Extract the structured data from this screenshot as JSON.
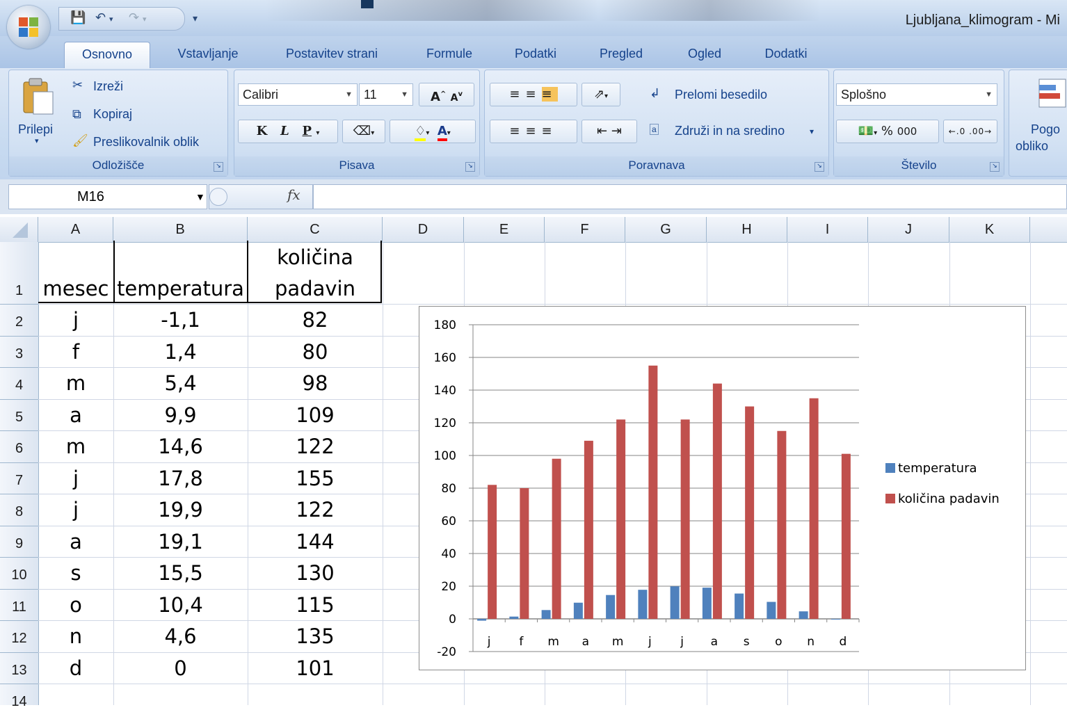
{
  "window": {
    "title": "Ljubljana_klimogram - Mi"
  },
  "qat": {
    "save_icon": "save-icon",
    "undo_icon": "undo-icon",
    "redo_icon": "redo-icon"
  },
  "tabs": [
    {
      "label": "Osnovno",
      "active": true
    },
    {
      "label": "Vstavljanje"
    },
    {
      "label": "Postavitev strani"
    },
    {
      "label": "Formule"
    },
    {
      "label": "Podatki"
    },
    {
      "label": "Pregled"
    },
    {
      "label": "Ogled"
    },
    {
      "label": "Dodatki"
    }
  ],
  "ribbon": {
    "clipboard": {
      "label": "Odložišče",
      "paste": "Prilepi",
      "cut": "Izreži",
      "copy": "Kopiraj",
      "format_painter": "Preslikovalnik oblik"
    },
    "font": {
      "label": "Pisava",
      "font_name": "Calibri",
      "font_size": "11",
      "bold": "K",
      "italic": "L",
      "underline": "P"
    },
    "alignment": {
      "label": "Poravnava",
      "wrap": "Prelomi besedilo",
      "merge": "Združi in na sredino"
    },
    "number": {
      "label": "Število",
      "format": "Splošno",
      "percent": "%",
      "thousands": "000"
    },
    "styles": {
      "label_1": "Pogo",
      "label_2": "obliko"
    }
  },
  "formula_bar": {
    "name_box": "M16",
    "fx": "fx",
    "value": ""
  },
  "columns": [
    "A",
    "B",
    "C",
    "D",
    "E",
    "F",
    "G",
    "H",
    "I",
    "J",
    "K"
  ],
  "rows": [
    "1",
    "2",
    "3",
    "4",
    "5",
    "6",
    "7",
    "8",
    "9",
    "10",
    "11",
    "12",
    "13",
    "14"
  ],
  "table": {
    "headers": {
      "a": "mesec",
      "b": "temperatura",
      "c1": "količina",
      "c2": "padavin"
    },
    "data": [
      [
        "j",
        "-1,1",
        "82"
      ],
      [
        "f",
        "1,4",
        "80"
      ],
      [
        "m",
        "5,4",
        "98"
      ],
      [
        "a",
        "9,9",
        "109"
      ],
      [
        "m",
        "14,6",
        "122"
      ],
      [
        "j",
        "17,8",
        "155"
      ],
      [
        "j",
        "19,9",
        "122"
      ],
      [
        "a",
        "19,1",
        "144"
      ],
      [
        "s",
        "15,5",
        "130"
      ],
      [
        "o",
        "10,4",
        "115"
      ],
      [
        "n",
        "4,6",
        "135"
      ],
      [
        "d",
        "0",
        "101"
      ]
    ]
  },
  "chart_data": {
    "type": "bar",
    "categories": [
      "j",
      "f",
      "m",
      "a",
      "m",
      "j",
      "j",
      "a",
      "s",
      "o",
      "n",
      "d"
    ],
    "series": [
      {
        "name": "temperatura",
        "values": [
          -1.1,
          1.4,
          5.4,
          9.9,
          14.6,
          17.8,
          19.9,
          19.1,
          15.5,
          10.4,
          4.6,
          0
        ],
        "color": "#4f81bd"
      },
      {
        "name": "količina padavin",
        "values": [
          82,
          80,
          98,
          109,
          122,
          155,
          122,
          144,
          130,
          115,
          135,
          101
        ],
        "color": "#c0504d"
      }
    ],
    "ylim": [
      -20,
      180
    ],
    "yticks": [
      180,
      160,
      140,
      120,
      100,
      80,
      60,
      40,
      20,
      0,
      -20
    ],
    "grid": true,
    "legend": "right"
  }
}
